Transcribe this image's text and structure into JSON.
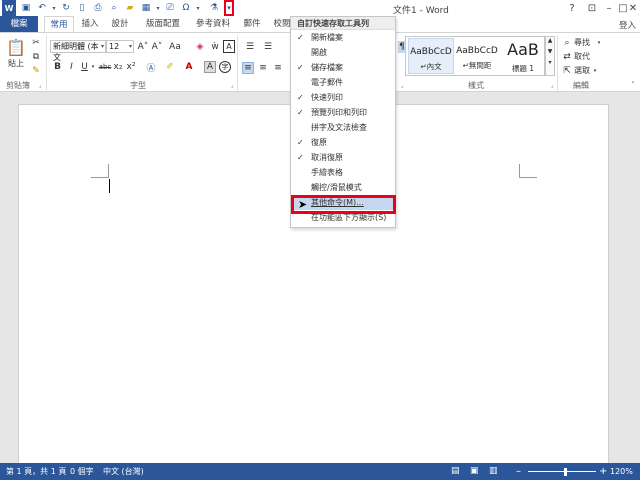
{
  "window": {
    "title": "文件1 - Word",
    "sign_in": "登入"
  },
  "tabs": [
    {
      "label": "檔案"
    },
    {
      "label": "常用"
    },
    {
      "label": "插入"
    },
    {
      "label": "設計"
    },
    {
      "label": "版面配置"
    },
    {
      "label": "參考資料"
    },
    {
      "label": "郵件"
    },
    {
      "label": "校閱"
    }
  ],
  "ribbon": {
    "clipboard": {
      "paste": "貼上",
      "label": "剪貼簿"
    },
    "font": {
      "font_name": "新細明體 (本文",
      "font_size": "12",
      "grow": "A˄",
      "shrink": "A˅",
      "case": "Aa",
      "bold": "B",
      "italic": "I",
      "underline": "U",
      "strike": "abc",
      "subscript": "x₂",
      "superscript": "x²",
      "label": "字型"
    },
    "styles": {
      "items": [
        {
          "preview": "AaBbCcD",
          "name": "↵內文"
        },
        {
          "preview": "AaBbCcD",
          "name": "↵無間距"
        },
        {
          "preview": "AaB",
          "name": "標題 1"
        }
      ],
      "label": "樣式"
    },
    "editing": {
      "find": "尋找",
      "replace": "取代",
      "select": "選取",
      "label": "編輯"
    }
  },
  "qat_menu": {
    "header": "自訂快速存取工具列",
    "items": [
      {
        "label": "開新檔案",
        "checked": true
      },
      {
        "label": "開啟",
        "checked": false
      },
      {
        "label": "儲存檔案",
        "checked": true
      },
      {
        "label": "電子郵件",
        "checked": false
      },
      {
        "label": "快速列印",
        "checked": true
      },
      {
        "label": "預覽列印和列印",
        "checked": true
      },
      {
        "label": "拼字及文法檢查",
        "checked": false
      },
      {
        "label": "復原",
        "checked": true
      },
      {
        "label": "取消復原",
        "checked": true
      },
      {
        "label": "手繪表格",
        "checked": false
      },
      {
        "label": "觸控/滑鼠模式",
        "checked": false
      },
      {
        "label": "其他命令(M)...",
        "checked": false,
        "highlighted": true
      },
      {
        "label": "在功能區下方顯示(S)",
        "checked": false
      }
    ]
  },
  "status": {
    "page": "第 1 頁，共 1 頁",
    "words": "0 個字",
    "language": "中文 (台灣)",
    "zoom": "120%",
    "zoom_level_fraction": 0.55
  },
  "colors": {
    "brand": "#2b579a",
    "highlight_red": "#e8001c"
  }
}
